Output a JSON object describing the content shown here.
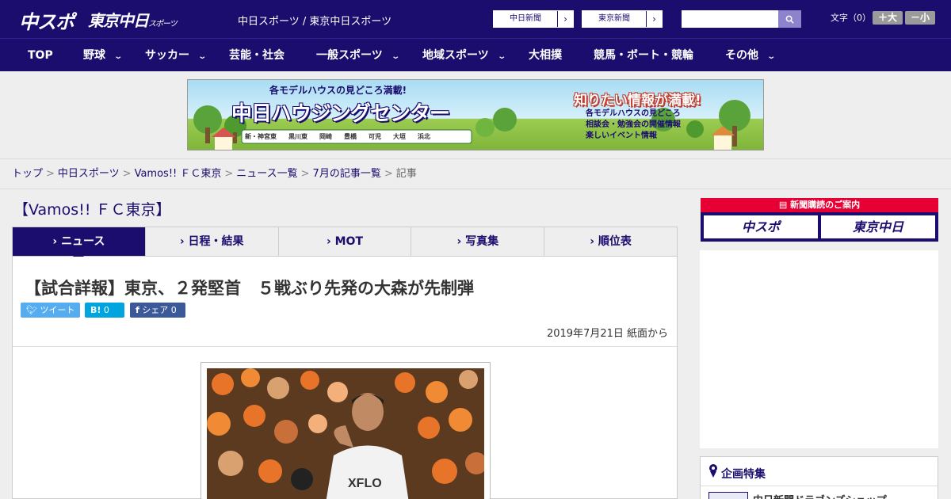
{
  "header": {
    "logo_chuspo": "中スポ",
    "logo_tokyo": "東京中日",
    "logo_tokyo_small": "スポーツ",
    "site_names": "中日スポーツ / 東京中日スポーツ",
    "paper_buttons": [
      "中日新聞",
      "東京新聞"
    ],
    "search_placeholder": "",
    "font_label": "文字（0）",
    "font_larger": "＋大",
    "font_smaller": "－小"
  },
  "nav": {
    "items": [
      {
        "label": "TOP",
        "dropdown": false
      },
      {
        "label": "野球",
        "dropdown": true
      },
      {
        "label": "サッカー",
        "dropdown": true
      },
      {
        "label": "芸能・社会",
        "dropdown": false
      },
      {
        "label": "一般スポーツ",
        "dropdown": true
      },
      {
        "label": "地域スポーツ",
        "dropdown": true
      },
      {
        "label": "大相撲",
        "dropdown": false
      },
      {
        "label": "競馬・ボート・競輪",
        "dropdown": false
      },
      {
        "label": "その他",
        "dropdown": true
      }
    ]
  },
  "banner": {
    "top_text": "各モデルハウスの見どころ満載!",
    "main_text": "中日ハウジングセンター",
    "locations": [
      "新・神宮東",
      "黒川東",
      "岡崎",
      "豊橋",
      "可児",
      "大垣",
      "浜北"
    ],
    "right_title": "知りたい情報が満載!",
    "right_items": [
      "各モデルハウスの見どころ",
      "相談会・勉強会の開催情報",
      "楽しいイベント情報"
    ]
  },
  "breadcrumb": {
    "links": [
      "トップ",
      "中日スポーツ",
      "Vamos!! ＦＣ東京",
      "ニュース一覧",
      "7月の記事一覧"
    ],
    "current": "記事"
  },
  "section": {
    "heading": "【Vamos!! ＦＣ東京】"
  },
  "tabs": [
    {
      "label": "ニュース",
      "active": true
    },
    {
      "label": "日程・結果",
      "active": false
    },
    {
      "label": "MOT",
      "active": false
    },
    {
      "label": "写真集",
      "active": false
    },
    {
      "label": "順位表",
      "active": false
    }
  ],
  "article": {
    "title": "【試合詳報】東京、２発堅首　５戦ぶり先発の大森が先制弾",
    "share": {
      "tweet": "ツイート",
      "hatena_count": "0",
      "facebook": "シェア",
      "facebook_count": "0"
    },
    "date": "2019年7月21日 紙面から"
  },
  "sidebar": {
    "subscription_title": "新聞購読のご案内",
    "sub_buttons": [
      "中スポ",
      "東京中日"
    ],
    "feature_title": "企画特集",
    "feature_item": "中日新聞ドラゴンズショップ"
  },
  "colors": {
    "brand": "#1a0d6e",
    "twitter": "#55acee",
    "hatena": "#00a4de",
    "facebook": "#3b5998",
    "subscription_red": "#e60033"
  }
}
